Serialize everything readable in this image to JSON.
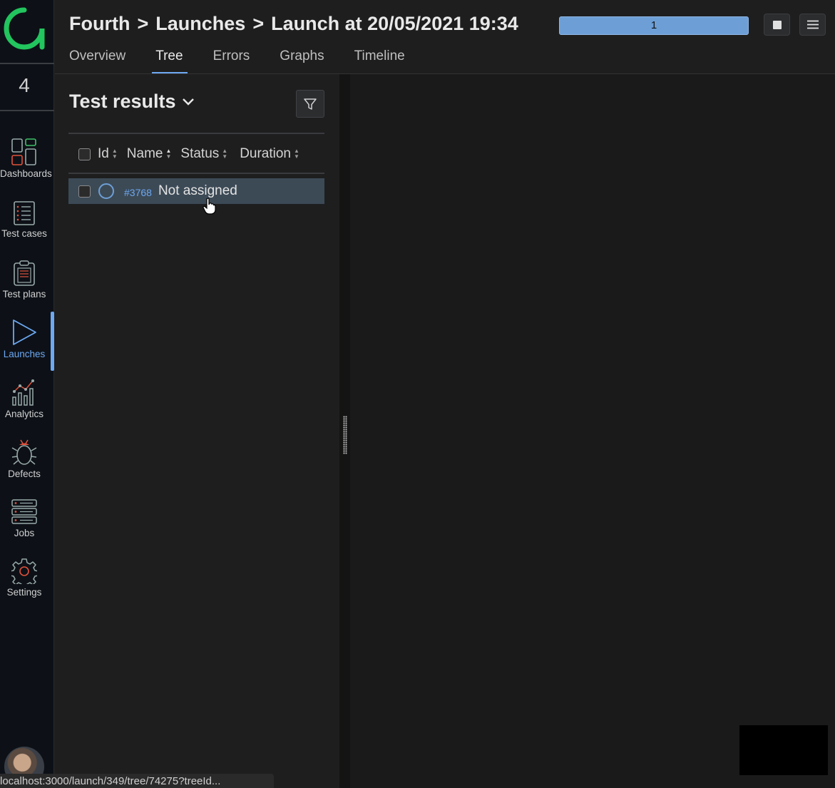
{
  "sidebar": {
    "project_number": "4",
    "items": [
      {
        "label": "Dashboards"
      },
      {
        "label": "Test cases"
      },
      {
        "label": "Test plans"
      },
      {
        "label": "Launches"
      },
      {
        "label": "Analytics"
      },
      {
        "label": "Defects"
      },
      {
        "label": "Jobs"
      },
      {
        "label": "Settings"
      }
    ],
    "active_item": "Launches"
  },
  "header": {
    "breadcrumb": [
      "Fourth",
      "Launches",
      "Launch at 20/05/2021 19:34"
    ],
    "separator": ">",
    "progress_label": "1",
    "progress_fraction": 1.0
  },
  "tabs": [
    {
      "label": "Overview"
    },
    {
      "label": "Tree"
    },
    {
      "label": "Errors"
    },
    {
      "label": "Graphs"
    },
    {
      "label": "Timeline"
    }
  ],
  "active_tab": "Tree",
  "tree": {
    "title": "Test results",
    "columns": [
      "Id",
      "Name",
      "Status",
      "Duration"
    ],
    "rows": [
      {
        "id": "#3768",
        "name": "Not assigned"
      }
    ]
  },
  "statusbar": {
    "url": "localhost:3000/launch/349/tree/74275?treeId..."
  },
  "colors": {
    "accent": "#6da8f2",
    "logo": "#22c55e",
    "sidebar_bg": "#0d1117",
    "selected_row": "#3c4a56"
  }
}
